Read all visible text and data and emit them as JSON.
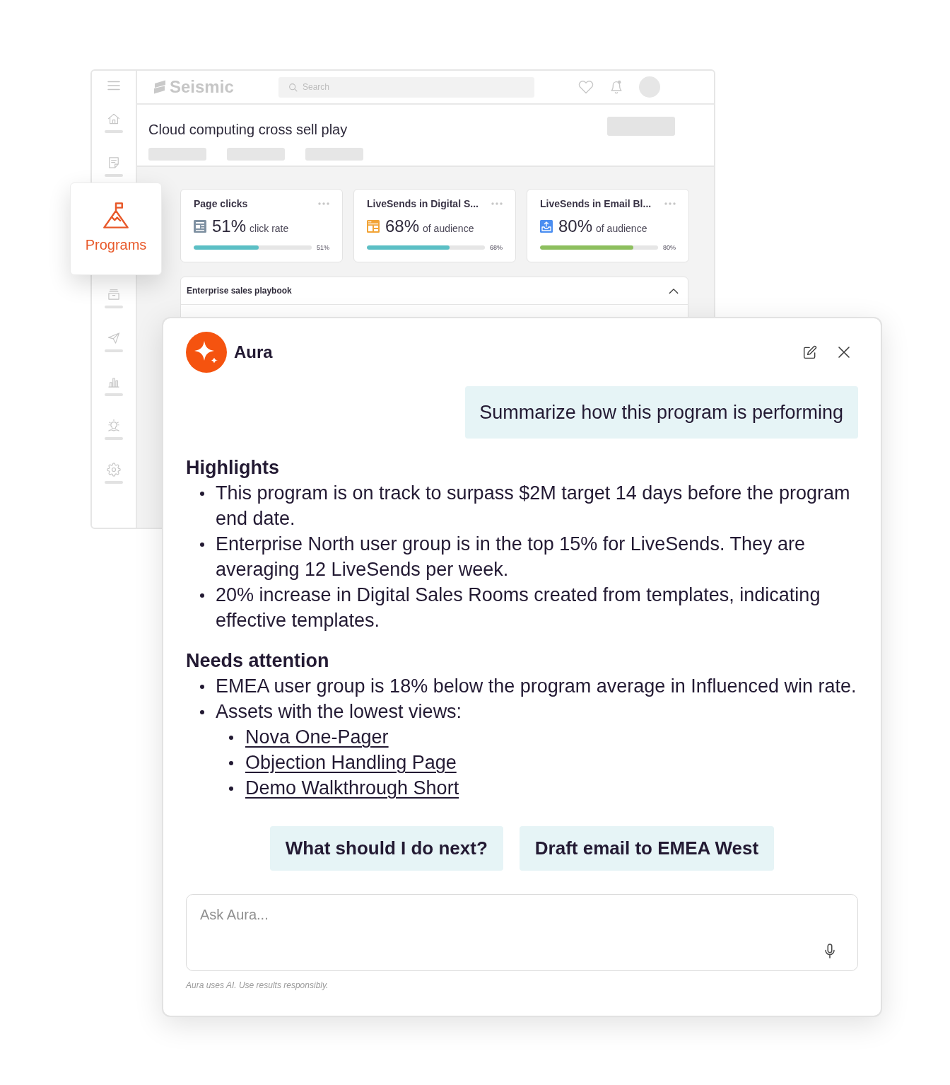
{
  "sidebar": {
    "items": [
      {
        "selected": false
      },
      {
        "selected": false
      },
      {
        "label": "Programs",
        "selected": true
      },
      {
        "selected": false
      },
      {
        "selected": false
      },
      {
        "selected": false
      },
      {
        "selected": false
      },
      {
        "selected": false
      }
    ]
  },
  "top_bar": {
    "app_name": "Seismic",
    "search": {
      "placeholder": "Search"
    }
  },
  "page_header": {
    "title": "Cloud computing cross sell play"
  },
  "metric_cards": [
    {
      "title": "Page clicks",
      "kind": "page",
      "value": "51%",
      "caption": "click rate",
      "level": 0.55,
      "reading": "51%",
      "color": "#5bbfc5"
    },
    {
      "title": "LiveSends in Digital S...",
      "kind": "room",
      "value": "68%",
      "caption": "of audience",
      "level": 0.7,
      "reading": "68%",
      "color": "#5bbfc5"
    },
    {
      "title": "LiveSends in Email Bl...",
      "kind": "email",
      "value": "80%",
      "caption": "of audience",
      "level": 0.79,
      "reading": "80%",
      "color": "#8dbf5e"
    }
  ],
  "playbook": {
    "title": "Enterprise sales playbook",
    "expanded": true
  },
  "aura": {
    "title": "Aura",
    "user_message": "Summarize how this program is performing",
    "sections": [
      {
        "heading": "Highlights",
        "items": [
          {
            "text": "This program is on track to surpass $2M target 14 days before the program end date."
          },
          {
            "text": "Enterprise North user group is in the top 15% for LiveSends. They are averaging 12 LiveSends per week."
          },
          {
            "text": "20% increase in Digital Sales Rooms created from templates, indicating effective templates."
          }
        ]
      },
      {
        "heading": "Needs attention",
        "items": [
          {
            "text": "EMEA user group is 18% below the program average in Influenced win rate."
          },
          {
            "text": "Assets with the lowest views:",
            "children": [
              {
                "text": "Nova One-Pager",
                "kind": "link"
              },
              {
                "text": "Objection Handling Page",
                "kind": "link"
              },
              {
                "text": "Demo Walkthrough Short",
                "kind": "link"
              }
            ]
          }
        ]
      }
    ],
    "suggestions": [
      "What should I do next?",
      "Draft email to EMEA West"
    ],
    "input": {
      "placeholder": "Ask Aura..."
    },
    "disclaimer": "Aura uses AI. Use results responsibly."
  }
}
